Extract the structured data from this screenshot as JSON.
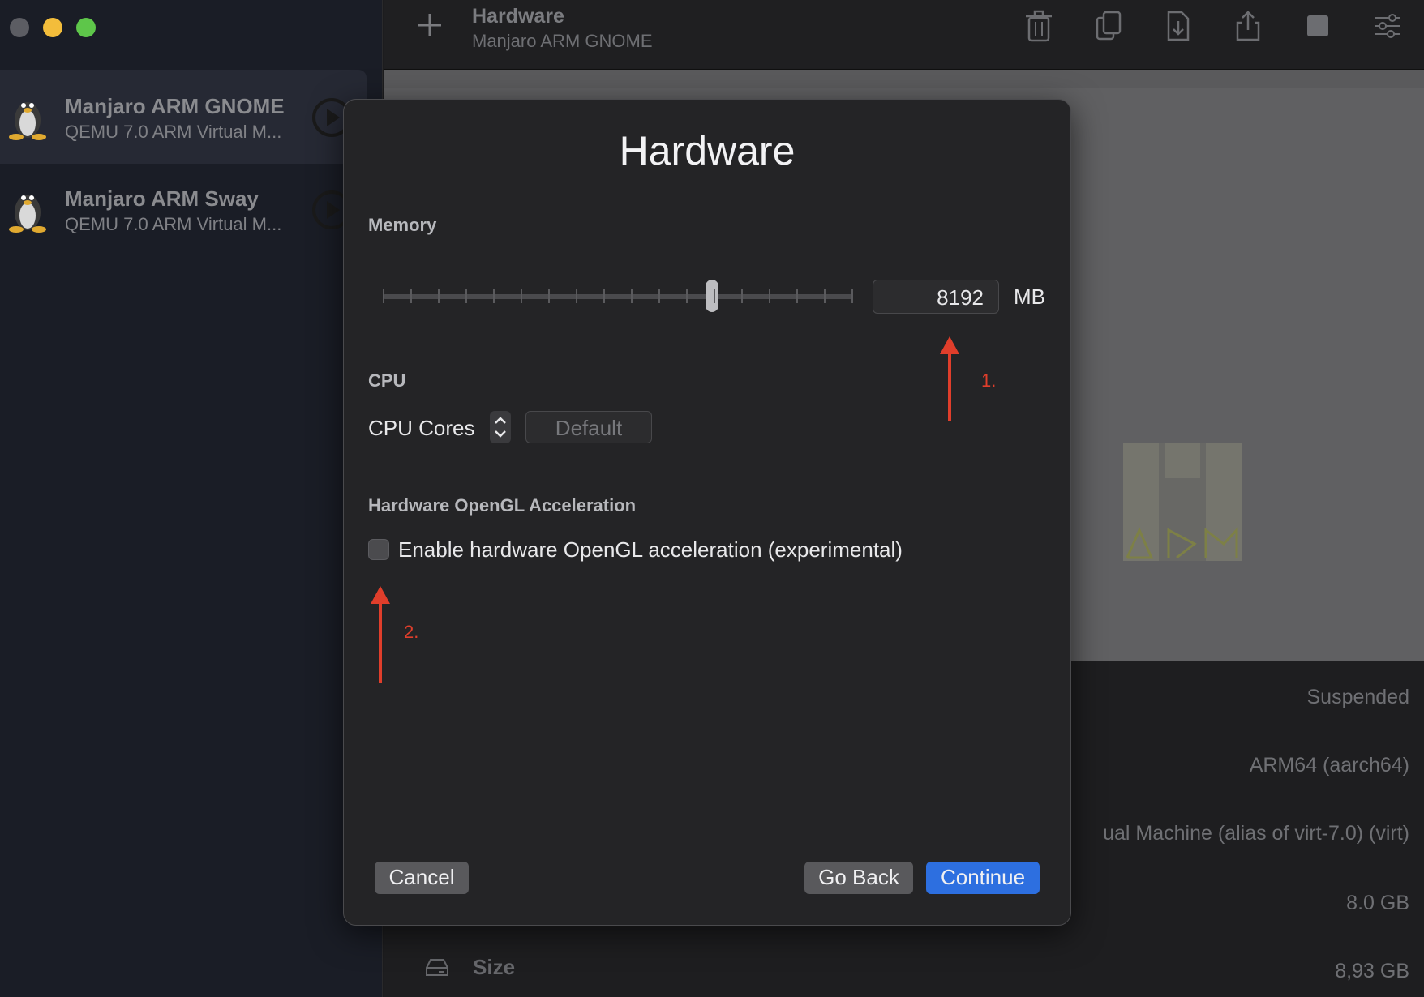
{
  "sidebar": {
    "vms": [
      {
        "name": "Manjaro ARM GNOME",
        "subtitle": "QEMU 7.0 ARM Virtual M...",
        "icon": "linux-penguin-icon"
      },
      {
        "name": "Manjaro ARM Sway",
        "subtitle": "QEMU 7.0 ARM Virtual M...",
        "icon": "linux-penguin-icon"
      }
    ]
  },
  "toolbar": {
    "title": "Hardware",
    "subtitle": "Manjaro ARM GNOME"
  },
  "info": {
    "status": "Suspended",
    "architecture": "ARM64 (aarch64)",
    "machine": "ual Machine (alias of virt-7.0) (virt)",
    "memory": "8.0 GB",
    "size_label": "Size",
    "size_value": "8,93 GB"
  },
  "modal": {
    "title": "Hardware",
    "memory_section": "Memory",
    "memory_value": "8192",
    "memory_unit": "MB",
    "memory_slider_fraction": 0.7,
    "cpu_section": "CPU",
    "cpu_cores_label": "CPU Cores",
    "cpu_cores_placeholder": "Default",
    "opengl_section": "Hardware OpenGL Acceleration",
    "opengl_checkbox_label": "Enable hardware OpenGL acceleration (experimental)",
    "opengl_checked": false,
    "cancel_label": "Cancel",
    "back_label": "Go Back",
    "continue_label": "Continue"
  },
  "annotations": {
    "first": "1.",
    "second": "2."
  },
  "colors": {
    "accent": "#2d6fe0",
    "annotation": "#e03e2b"
  }
}
